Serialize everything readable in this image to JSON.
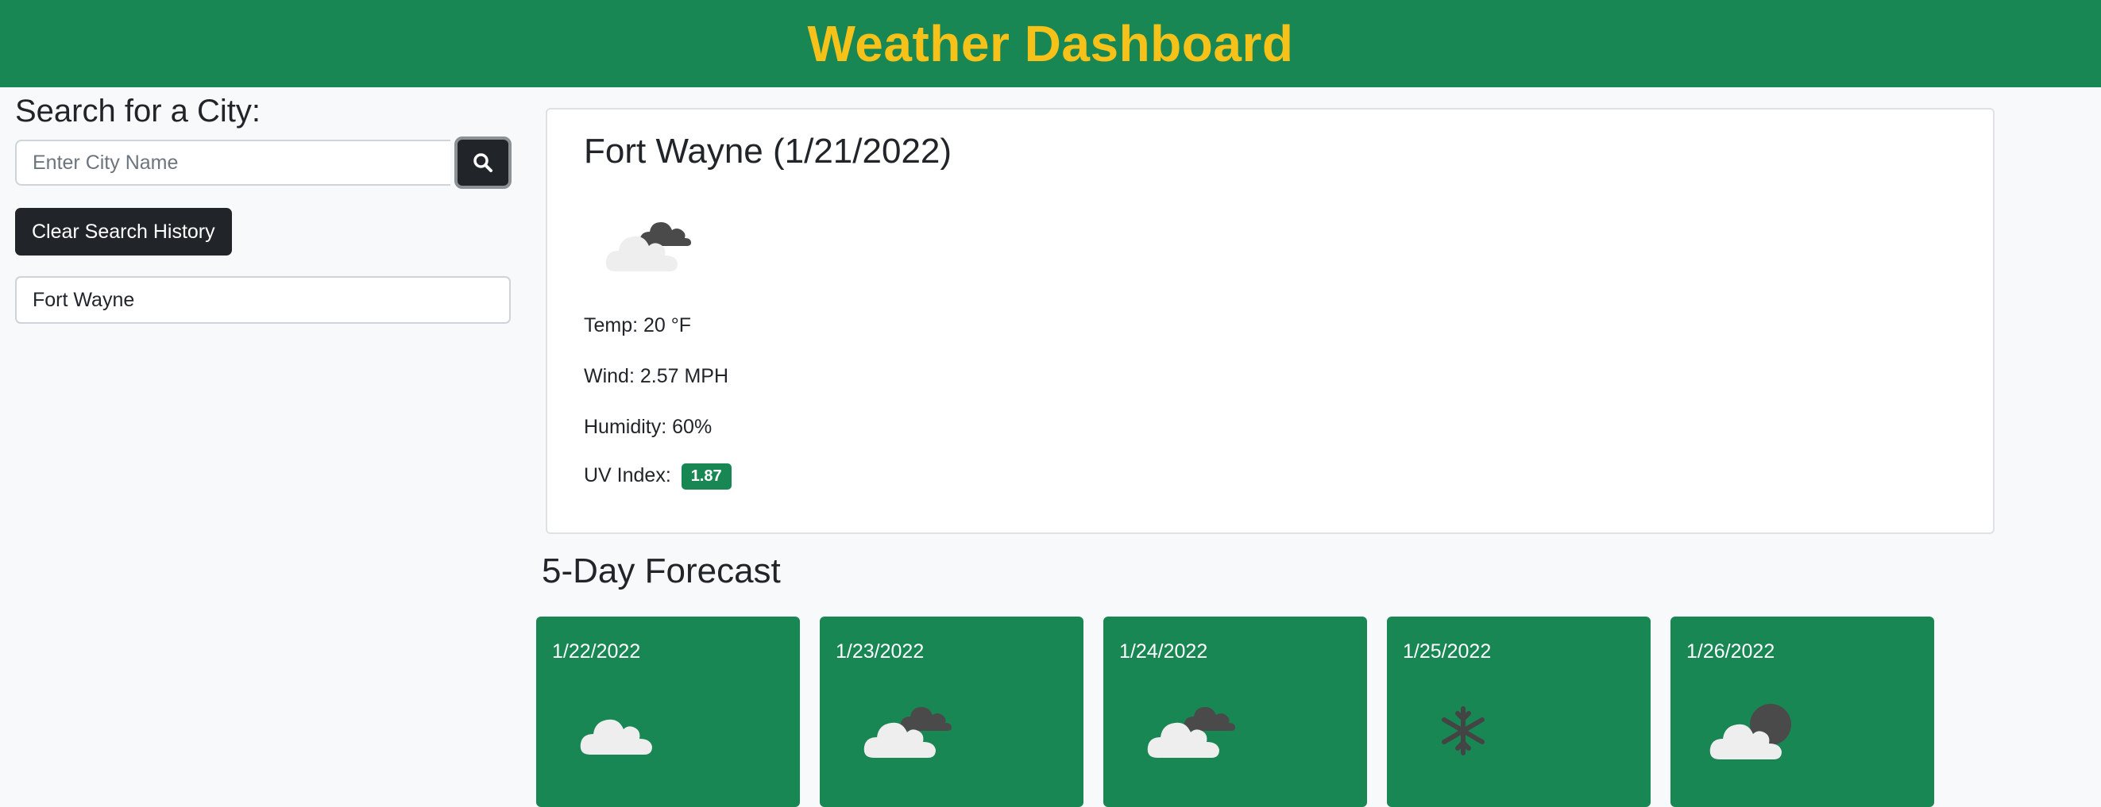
{
  "header": {
    "title": "Weather Dashboard"
  },
  "colors": {
    "brand_green": "#198754",
    "title_yellow": "#f6c118",
    "dark": "#212529"
  },
  "sidebar": {
    "search_title": "Search for a City:",
    "search_placeholder": "Enter City Name",
    "search_value": "",
    "search_button_icon": "search-icon",
    "clear_button_label": "Clear Search History",
    "history": [
      "Fort Wayne"
    ]
  },
  "current": {
    "city_title": "Fort Wayne (1/21/2022)",
    "icon": "partly-cloudy-icon",
    "temp": "Temp: 20 °F",
    "wind": "Wind: 2.57 MPH",
    "humidity": "Humidity: 60%",
    "uv_label": "UV Index:",
    "uv_value": "1.87"
  },
  "forecast": {
    "title": "5-Day Forecast",
    "days": [
      {
        "date": "1/22/2022",
        "icon": "cloud-icon"
      },
      {
        "date": "1/23/2022",
        "icon": "broken-clouds-icon"
      },
      {
        "date": "1/24/2022",
        "icon": "broken-clouds-icon"
      },
      {
        "date": "1/25/2022",
        "icon": "snowflake-icon"
      },
      {
        "date": "1/26/2022",
        "icon": "night-cloud-icon"
      }
    ]
  }
}
